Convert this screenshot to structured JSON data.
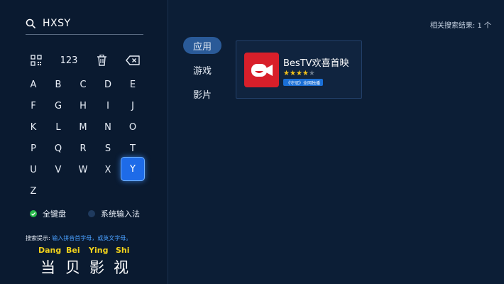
{
  "search": {
    "query": "HXSY"
  },
  "keyboard": {
    "function_keys": {
      "number_label": "123"
    },
    "letters": [
      "A",
      "B",
      "C",
      "D",
      "E",
      "F",
      "G",
      "H",
      "I",
      "J",
      "K",
      "L",
      "M",
      "N",
      "O",
      "P",
      "Q",
      "R",
      "S",
      "T",
      "U",
      "V",
      "W",
      "X",
      "Y",
      "Z"
    ],
    "active_key": "Y"
  },
  "input_modes": [
    {
      "label": "全键盘",
      "selected": true
    },
    {
      "label": "系统输入法",
      "selected": false
    }
  ],
  "hint": {
    "label": "搜索提示:",
    "text": "输入拼音首字母，或英文字母。"
  },
  "brand": {
    "pinyin": [
      "Dang",
      "Bei",
      "Ying",
      "Shi"
    ],
    "hanzi": [
      "当",
      "贝",
      "影",
      "视"
    ]
  },
  "tabs": [
    {
      "label": "应用",
      "active": true
    },
    {
      "label": "游戏",
      "active": false
    },
    {
      "label": "影片",
      "active": false
    }
  ],
  "results": {
    "count_text": "相关搜索结果: 1 个",
    "items": [
      {
        "name": "BesTV欢喜首映",
        "rating": 4,
        "rating_max": 5,
        "badge": "《守冠》全网独播"
      }
    ]
  },
  "colors": {
    "accent": "#1e6be8",
    "brand_yellow": "#f2d21b",
    "app_icon": "#d81f2a",
    "selected_mode": "#27b84a"
  }
}
